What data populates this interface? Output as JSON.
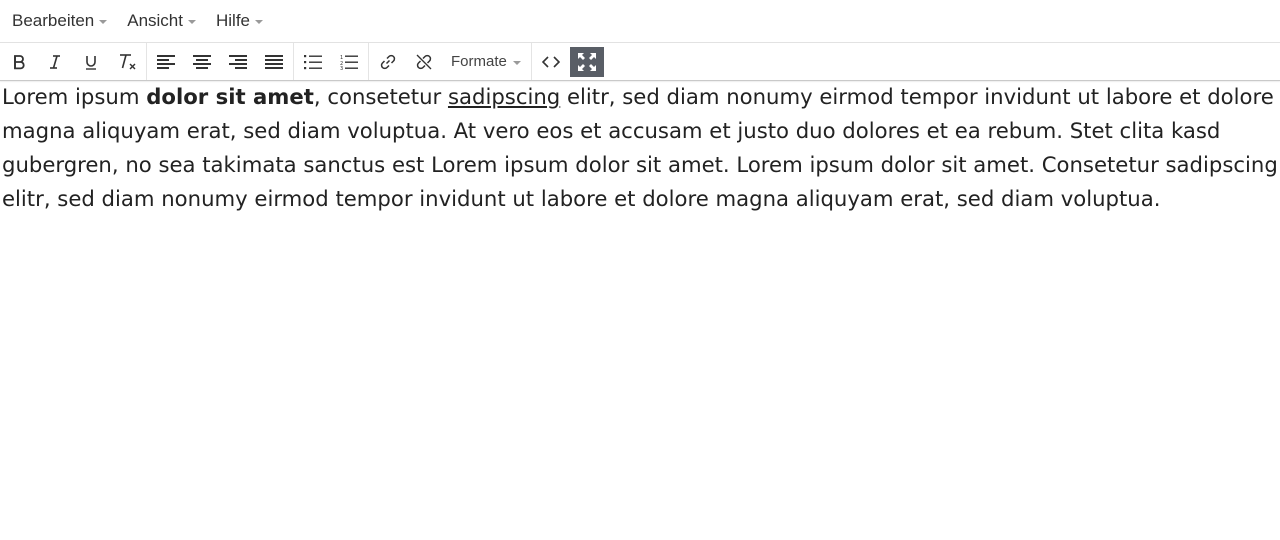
{
  "menubar": {
    "items": [
      {
        "label": "Bearbeiten"
      },
      {
        "label": "Ansicht"
      },
      {
        "label": "Hilfe"
      }
    ]
  },
  "toolbar": {
    "formats_label": "Formate",
    "buttons": [
      {
        "icon": "bold-icon"
      },
      {
        "icon": "italic-icon"
      },
      {
        "icon": "underline-icon"
      },
      {
        "icon": "clear-formatting-icon"
      },
      {
        "icon": "align-left-icon"
      },
      {
        "icon": "align-center-icon"
      },
      {
        "icon": "align-right-icon"
      },
      {
        "icon": "align-justify-icon"
      },
      {
        "icon": "bullet-list-icon"
      },
      {
        "icon": "numbered-list-icon"
      },
      {
        "icon": "link-icon"
      },
      {
        "icon": "unlink-icon"
      },
      {
        "icon": "code-icon"
      },
      {
        "icon": "fullscreen-icon"
      }
    ],
    "active_color": "#595e66"
  },
  "editor": {
    "seg1": "Lorem ipsum ",
    "bold": "dolor sit amet",
    "seg2": ", consetetur ",
    "underline": "sadipscing",
    "seg3": " elitr, sed diam nonumy eirmod tempor invidunt ut labore et dolore magna aliquyam erat, sed diam voluptua. At vero eos et accusam et justo duo dolores et ea rebum.  Stet clita kasd gubergren, no sea takimata sanctus est Lorem ipsum dolor sit amet. Lorem ipsum dolor sit amet. Consetetur sadipscing elitr, sed diam nonumy eirmod tempor invidunt ut labore et dolore magna aliquyam erat, sed diam voluptua."
  }
}
